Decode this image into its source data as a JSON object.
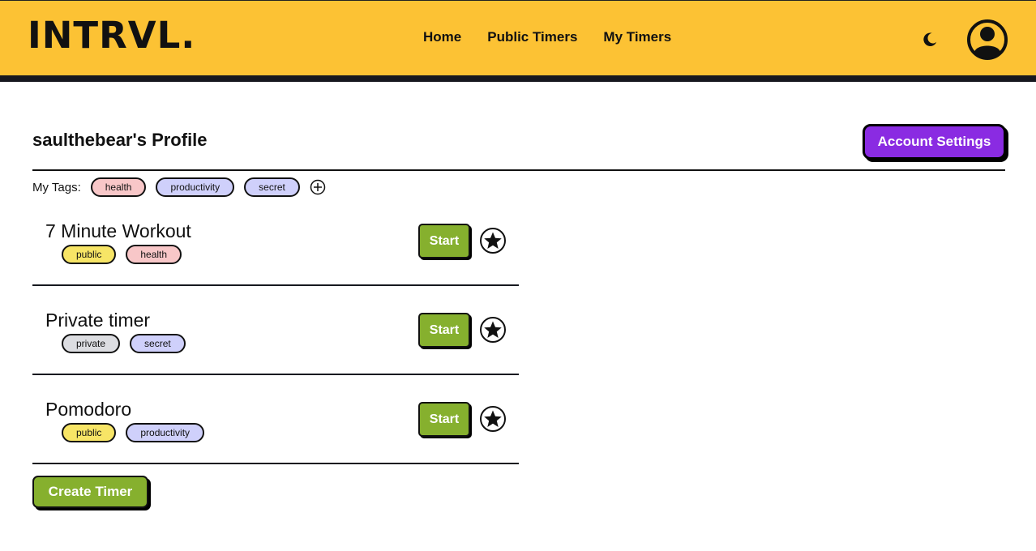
{
  "header": {
    "logo": "INTRVL.",
    "nav": [
      "Home",
      "Public Timers",
      "My Timers"
    ],
    "theme_icon": "moon-icon",
    "profile_icon": "user-avatar-icon"
  },
  "profile": {
    "title": "saulthebear's Profile",
    "account_settings_label": "Account Settings",
    "tags_label": "My Tags:",
    "tags": [
      "health",
      "productivity",
      "secret"
    ],
    "add_tag_icon": "plus-circle-icon"
  },
  "timers": [
    {
      "name": "7 Minute Workout",
      "tags": [
        "public",
        "health"
      ],
      "start_label": "Start",
      "favorite_icon": "star-icon"
    },
    {
      "name": "Private timer",
      "tags": [
        "private",
        "secret"
      ],
      "start_label": "Start",
      "favorite_icon": "star-icon"
    },
    {
      "name": "Pomodoro",
      "tags": [
        "public",
        "productivity"
      ],
      "start_label": "Start",
      "favorite_icon": "star-icon"
    }
  ],
  "create_timer_label": "Create Timer",
  "colors": {
    "header_bg": "#fcc234",
    "accent_purple": "#8a2be2",
    "button_green": "#86b02e",
    "tag_health": "#f8c7c8",
    "tag_productivity": "#cfd0fb",
    "tag_public": "#f7e566",
    "tag_private": "#dcdde1"
  }
}
